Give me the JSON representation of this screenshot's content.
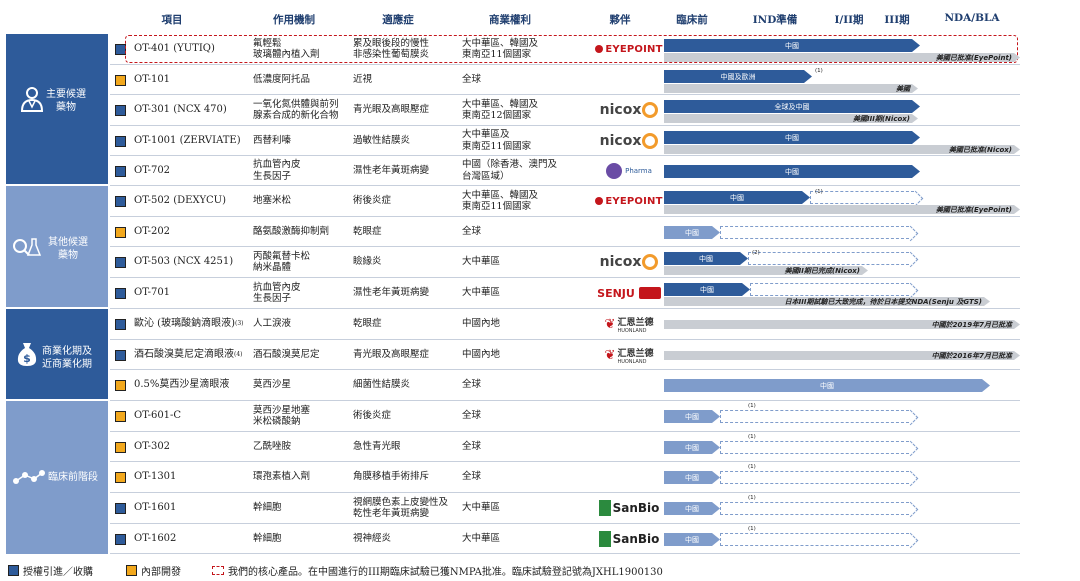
{
  "headers": {
    "project": "項目",
    "mechanism": "作用機制",
    "indication": "適應症",
    "rights": "商業權利",
    "partner": "夥伴",
    "preclinical": "臨床前",
    "ind": "IND準備",
    "phase12": "I/II期",
    "phase3": "III期",
    "nda": "NDA/BLA"
  },
  "categories": [
    {
      "id": "core",
      "label_line1": "主要候選",
      "label_line2": "藥物",
      "icon": "doctor-icon"
    },
    {
      "id": "other",
      "label_line1": "其他候選",
      "label_line2": "藥物",
      "icon": "lab-magnifier-icon"
    },
    {
      "id": "commercial",
      "label_line1": "商業化期及",
      "label_line2": "近商業化期",
      "icon": "money-bag-icon"
    },
    {
      "id": "preclinical",
      "label_line1": "臨床前階段",
      "label_line2": "",
      "icon": "molecule-network-icon"
    }
  ],
  "rows": [
    {
      "type": "lic",
      "name": "OT-401 (YUTIQ)",
      "sup": "",
      "mech1": "氟輕鬆",
      "mech2": "玻璃體內植入劑",
      "ind1": "累及眼後段的慢性",
      "ind2": "非感染性葡萄膜炎",
      "rights1": "大中華區、韓國及",
      "rights2": "東南亞11個國家",
      "partner": "EYEPOINT",
      "bar_label": "中國",
      "gray_label": "美國已批准(EyePoint)",
      "note": ""
    },
    {
      "type": "own",
      "name": "OT-101",
      "sup": "",
      "mech1": "低濃度阿托品",
      "mech2": "",
      "ind1": "近視",
      "ind2": "",
      "rights1": "全球",
      "rights2": "",
      "partner": "",
      "bar_label": "中國及歐洲",
      "gray_label": "美國",
      "note": "(1)"
    },
    {
      "type": "lic",
      "name": "OT-301 (NCX 470)",
      "sup": "",
      "mech1": "一氧化氮供體與前列",
      "mech2": "腺素合成的新化合物",
      "ind1": "青光眼及高眼壓症",
      "ind2": "",
      "rights1": "大中華區、韓國及",
      "rights2": "東南亞12個國家",
      "partner": "nicox",
      "bar_label": "全球及中國",
      "gray_label": "美國III期(Nicox)",
      "note": ""
    },
    {
      "type": "lic",
      "name": "OT-1001 (ZERVIATE)",
      "sup": "",
      "mech1": "西替利嗪",
      "mech2": "",
      "ind1": "過敏性結膜炎",
      "ind2": "",
      "rights1": "大中華區及",
      "rights2": "東南亞11個國家",
      "partner": "nicox",
      "bar_label": "中國",
      "gray_label": "美國已批准(Nicox)",
      "note": ""
    },
    {
      "type": "lic",
      "name": "OT-702",
      "sup": "",
      "mech1": "抗血管內皮",
      "mech2": "生長因子",
      "ind1": "濕性老年黃斑病變",
      "ind2": "",
      "rights1": "中國（除香港、澳門及",
      "rights2": "台灣區域）",
      "partner": "Pharma",
      "bar_label": "中國",
      "gray_label": "",
      "note": ""
    },
    {
      "type": "lic",
      "name": "OT-502 (DEXYCU)",
      "sup": "",
      "mech1": "地塞米松",
      "mech2": "",
      "ind1": "術後炎症",
      "ind2": "",
      "rights1": "大中華區、韓國及",
      "rights2": "東南亞11個國家",
      "partner": "EYEPOINT",
      "bar_label": "中國",
      "gray_label": "美國已批准(EyePoint)",
      "note": "(1)"
    },
    {
      "type": "own",
      "name": "OT-202",
      "sup": "",
      "mech1": "酪氨酸激酶抑制劑",
      "mech2": "",
      "ind1": "乾眼症",
      "ind2": "",
      "rights1": "全球",
      "rights2": "",
      "partner": "",
      "bar_label": "中國",
      "gray_label": "",
      "note": ""
    },
    {
      "type": "lic",
      "name": "OT-503 (NCX 4251)",
      "sup": "",
      "mech1": "丙酸氟替卡松",
      "mech2": "納米晶體",
      "ind1": "瞼緣炎",
      "ind2": "",
      "rights1": "大中華區",
      "rights2": "",
      "partner": "nicox",
      "bar_label": "中國",
      "gray_label": "美國II期已完成(Nicox)",
      "note": "(2)"
    },
    {
      "type": "lic",
      "name": "OT-701",
      "sup": "",
      "mech1": "抗血管內皮",
      "mech2": "生長因子",
      "ind1": "濕性老年黃斑病變",
      "ind2": "",
      "rights1": "大中華區",
      "rights2": "",
      "partner": "SENJU",
      "bar_label": "中國",
      "gray_label": "日本III期試驗已大致完成，待於日本提交NDA(Senju 及GTS)",
      "note": ""
    },
    {
      "type": "lic",
      "name": "歐沁 (玻璃酸鈉滴眼液)",
      "sup": "(3)",
      "mech1": "人工淚液",
      "mech2": "",
      "ind1": "乾眼症",
      "ind2": "",
      "rights1": "中國內地",
      "rights2": "",
      "partner": "HUONLAND",
      "bar_label": "",
      "gray_label": "中國於2019年7月已批准",
      "note": ""
    },
    {
      "type": "lic",
      "name": "酒石酸溴莫尼定滴眼液",
      "sup": "(4)",
      "mech1": "酒石酸溴莫尼定",
      "mech2": "",
      "ind1": "青光眼及高眼壓症",
      "ind2": "",
      "rights1": "中國內地",
      "rights2": "",
      "partner": "HUONLAND",
      "bar_label": "",
      "gray_label": "中國於2016年7月已批准",
      "note": ""
    },
    {
      "type": "own",
      "name": "0.5%莫西沙星滴眼液",
      "sup": "",
      "mech1": "莫西沙星",
      "mech2": "",
      "ind1": "細菌性結膜炎",
      "ind2": "",
      "rights1": "全球",
      "rights2": "",
      "partner": "",
      "bar_label": "中國",
      "gray_label": "",
      "note": ""
    },
    {
      "type": "own",
      "name": "OT-601-C",
      "sup": "",
      "mech1": "莫西沙星地塞",
      "mech2": "米松磷酸鈉",
      "ind1": "術後炎症",
      "ind2": "",
      "rights1": "全球",
      "rights2": "",
      "partner": "",
      "bar_label": "中國",
      "gray_label": "",
      "note": "(1)"
    },
    {
      "type": "own",
      "name": "OT-302",
      "sup": "",
      "mech1": "乙酰唑胺",
      "mech2": "",
      "ind1": "急性青光眼",
      "ind2": "",
      "rights1": "全球",
      "rights2": "",
      "partner": "",
      "bar_label": "中國",
      "gray_label": "",
      "note": "(1)"
    },
    {
      "type": "own",
      "name": "OT-1301",
      "sup": "",
      "mech1": "環孢素植入劑",
      "mech2": "",
      "ind1": "角膜移植手術排斥",
      "ind2": "",
      "rights1": "全球",
      "rights2": "",
      "partner": "",
      "bar_label": "中國",
      "gray_label": "",
      "note": "(1)"
    },
    {
      "type": "lic",
      "name": "OT-1601",
      "sup": "",
      "mech1": "幹細胞",
      "mech2": "",
      "ind1": "視網膜色素上皮變性及",
      "ind2": "乾性老年黃斑病變",
      "rights1": "大中華區",
      "rights2": "",
      "partner": "SanBio",
      "bar_label": "中國",
      "gray_label": "",
      "note": "(1)"
    },
    {
      "type": "lic",
      "name": "OT-1602",
      "sup": "",
      "mech1": "幹細胞",
      "mech2": "",
      "ind1": "視神經炎",
      "ind2": "",
      "rights1": "大中華區",
      "rights2": "",
      "partner": "SanBio",
      "bar_label": "中國",
      "gray_label": "",
      "note": "(1)"
    }
  ],
  "partners": {
    "eyepoint": "EYEPOINT",
    "nicox": "nicox",
    "pharma": "Pharma",
    "senju": "SENJU",
    "huonland_cn": "汇恩兰德",
    "huonland_en": "HUONLAND",
    "sanbio": "SanBio"
  },
  "legend": {
    "licensed": "授權引進／收購",
    "inhouse": "內部開發",
    "core_note": "我們的核心產品。在中國進行的III期臨床試驗已獲NMPA批准。臨床試驗登記號為JXHL1900130"
  },
  "colors": {
    "dark_blue": "#2e5b9a",
    "light_blue": "#7f9ccb",
    "orange": "#f2a81d",
    "gray": "#c9cdd3",
    "red": "#c4161c"
  }
}
